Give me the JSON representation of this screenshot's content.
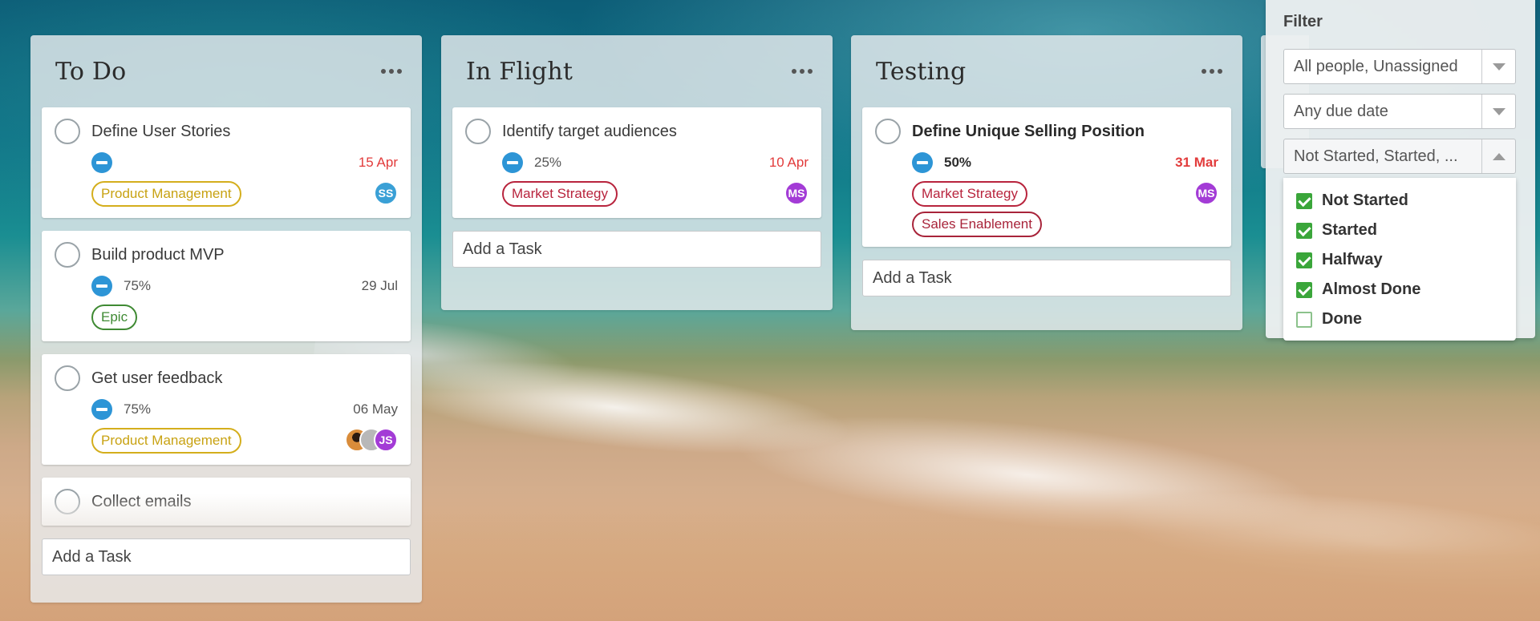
{
  "columns": [
    {
      "title": "To Do",
      "add_task_placeholder": "Add a Task",
      "cards": [
        {
          "name": "Define User Stories",
          "progress": "",
          "due": "15 Apr",
          "tags": [
            "Product Management"
          ],
          "avatars": [
            "SS"
          ]
        },
        {
          "name": "Build product MVP",
          "progress": "75%",
          "due": "29 Jul",
          "tags": [
            "Epic"
          ],
          "avatars": []
        },
        {
          "name": "Get user feedback",
          "progress": "75%",
          "due": "06 May",
          "tags": [
            "Product Management"
          ],
          "avatars": [
            "JS"
          ]
        },
        {
          "name": "Collect emails"
        }
      ]
    },
    {
      "title": "In Flight",
      "add_task_placeholder": "Add a Task",
      "cards": [
        {
          "name": "Identify target audiences",
          "progress": "25%",
          "due": "10 Apr",
          "tags": [
            "Market Strategy"
          ],
          "avatars": [
            "MS"
          ]
        }
      ]
    },
    {
      "title": "Testing",
      "add_task_placeholder": "Add a Task",
      "cards": [
        {
          "name": "Define Unique Selling Position",
          "progress": "50%",
          "due": "31 Mar",
          "tags": [
            "Market Strategy",
            "Sales Enablement"
          ],
          "avatars": [
            "MS"
          ]
        }
      ]
    }
  ],
  "filter": {
    "title": "Filter",
    "people": "All people, Unassigned",
    "due_date": "Any due date",
    "status": "Not Started, Started, ...",
    "status_options": [
      {
        "label": "Not Started",
        "checked": true
      },
      {
        "label": "Started",
        "checked": true
      },
      {
        "label": "Halfway",
        "checked": true
      },
      {
        "label": "Almost Done",
        "checked": true
      },
      {
        "label": "Done",
        "checked": false
      }
    ]
  },
  "colors": {
    "progress_blue": "#2d95d6",
    "due_overdue": "#e23b3b",
    "tag_product_management": "#d4ae1c",
    "tag_epic": "#3f8a33",
    "tag_market_strategy": "#b8243d",
    "checkbox_green": "#3aa63a",
    "avatar_ss": "#3aa0d6",
    "avatar_ms": "#a33bd6"
  },
  "icons": {
    "column_menu": "ellipsis-icon",
    "progress": "progress-minus-icon",
    "complete": "checkbox-circle-icon",
    "dropdown": "triangle-down-icon",
    "dropdown_open": "triangle-up-icon"
  }
}
